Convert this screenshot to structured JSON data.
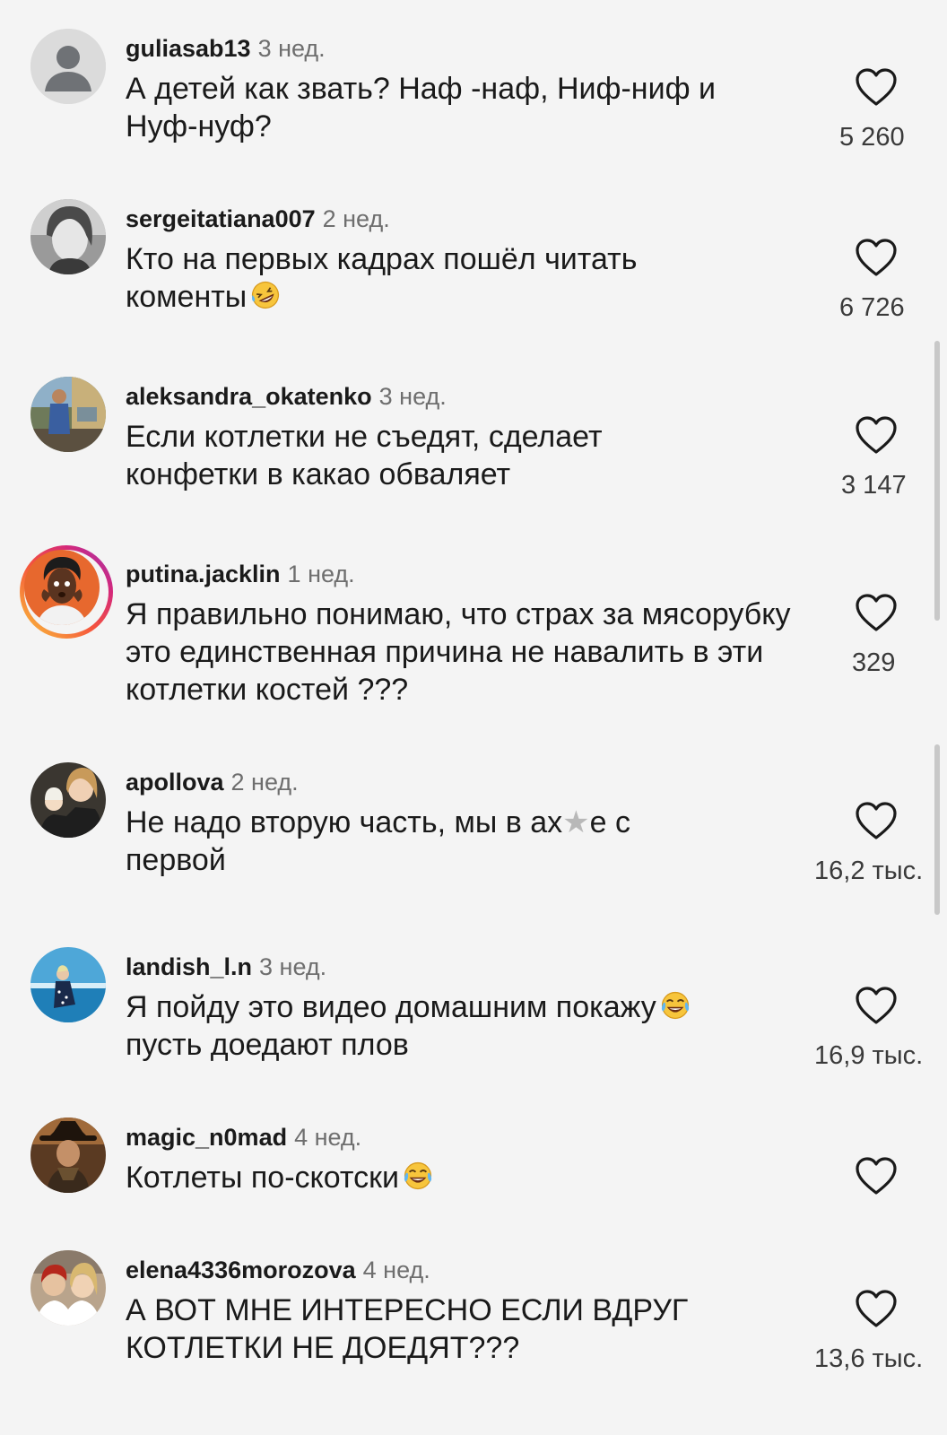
{
  "comments": [
    {
      "username": "guliasab13",
      "time": "3 нед.",
      "text": "А детей как звать? Наф -наф, Ниф-ниф и Нуф-нуф?",
      "likes": "5 260",
      "avatar": "default-avatar-icon"
    },
    {
      "username": "sergeitatiana007",
      "time": "2 нед.",
      "text": "Кто на первых кадрах пошёл читать коменты",
      "emoji": "rolling-on-floor-laughing-emoji",
      "likes": "6 726",
      "avatar": "profile-photo"
    },
    {
      "username": "aleksandra_okatenko",
      "time": "3 нед.",
      "text": "Если котлетки не съедят, сделает конфетки в какао обваляет",
      "likes": "3 147",
      "avatar": "profile-photo"
    },
    {
      "username": "putina.jacklin",
      "time": "1 нед.",
      "text": "Я правильно понимаю, что страх за мясорубку это единственная причина не навалить в эти котлетки костей ???",
      "likes": "329",
      "avatar": "profile-photo-with-story-ring"
    },
    {
      "username": "apollova",
      "time": "2 нед.",
      "text_before": "Не надо вторую часть, мы в ах",
      "text_after": "е с первой",
      "censor": "★",
      "likes": "16,2 тыс.",
      "avatar": "profile-photo"
    },
    {
      "username": "landish_l.n",
      "time": "3 нед.",
      "text_before": "Я пойду это видео домашним покажу",
      "text_after": "пусть доедают плов",
      "emoji": "face-with-tears-of-joy-emoji",
      "likes": "16,9 тыс.",
      "avatar": "profile-photo"
    },
    {
      "username": "magic_n0mad",
      "time": "4 нед.",
      "text": "Котлеты по-скотски",
      "emoji": "face-with-tears-of-joy-emoji",
      "likes": "",
      "avatar": "profile-photo"
    },
    {
      "username": "elena4336morozova",
      "time": "4 нед.",
      "text": "А ВОТ МНЕ ИНТЕРЕСНО ЕСЛИ ВДРУГ КОТЛЕТКИ НЕ ДОЕДЯТ???",
      "likes": "13,6 тыс.",
      "avatar": "profile-photo"
    }
  ],
  "colors": {
    "background": "#f4f4f4",
    "text": "#1a1a1a",
    "timestamp": "#6e6e6e",
    "like_count": "#3a3a3a",
    "story_ring": "#d4287b"
  }
}
